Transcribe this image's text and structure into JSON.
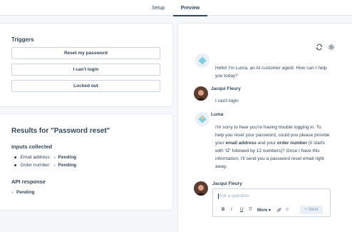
{
  "tabs": [
    {
      "label": "Setup"
    },
    {
      "label": "Preview"
    }
  ],
  "triggers": {
    "title": "Triggers",
    "buttons": [
      "Reset my password",
      "I can't login",
      "Locked out"
    ]
  },
  "results": {
    "title": "Results for \"Password reset\"",
    "inputs_heading": "Inputs collected",
    "inputs": [
      {
        "label": "Email address:",
        "status": "Pending"
      },
      {
        "label": "Order number:",
        "status": "Pending"
      }
    ],
    "api_heading": "API response",
    "api_status": "Pending"
  },
  "chat": {
    "messages": [
      {
        "sender": "",
        "text": "Hello! I'm Luma, an AI customer agent. How can I help you today?"
      },
      {
        "sender": "Jacqui Fleury",
        "text": "I can't login"
      },
      {
        "sender": "Luma",
        "text_parts": [
          "I'm sorry to hear you're having trouble logging in. To help you reset your password, could you please provide your ",
          "email address",
          " and your ",
          "order number",
          " (it starts with 'IZ' followed by 12 numbers)? Once I have this information, I'll send you a password reset email right away."
        ]
      },
      {
        "sender": "Jacqui Fleury",
        "text": ""
      }
    ],
    "composer": {
      "placeholder": "Ask a question",
      "more_label": "More",
      "send_label": "Send"
    }
  },
  "icons": [
    "refresh-icon",
    "settings-icon",
    "bold-icon",
    "italic-icon",
    "underline-icon",
    "clear-format-icon",
    "link-icon",
    "emoji-icon",
    "plus-icon"
  ]
}
